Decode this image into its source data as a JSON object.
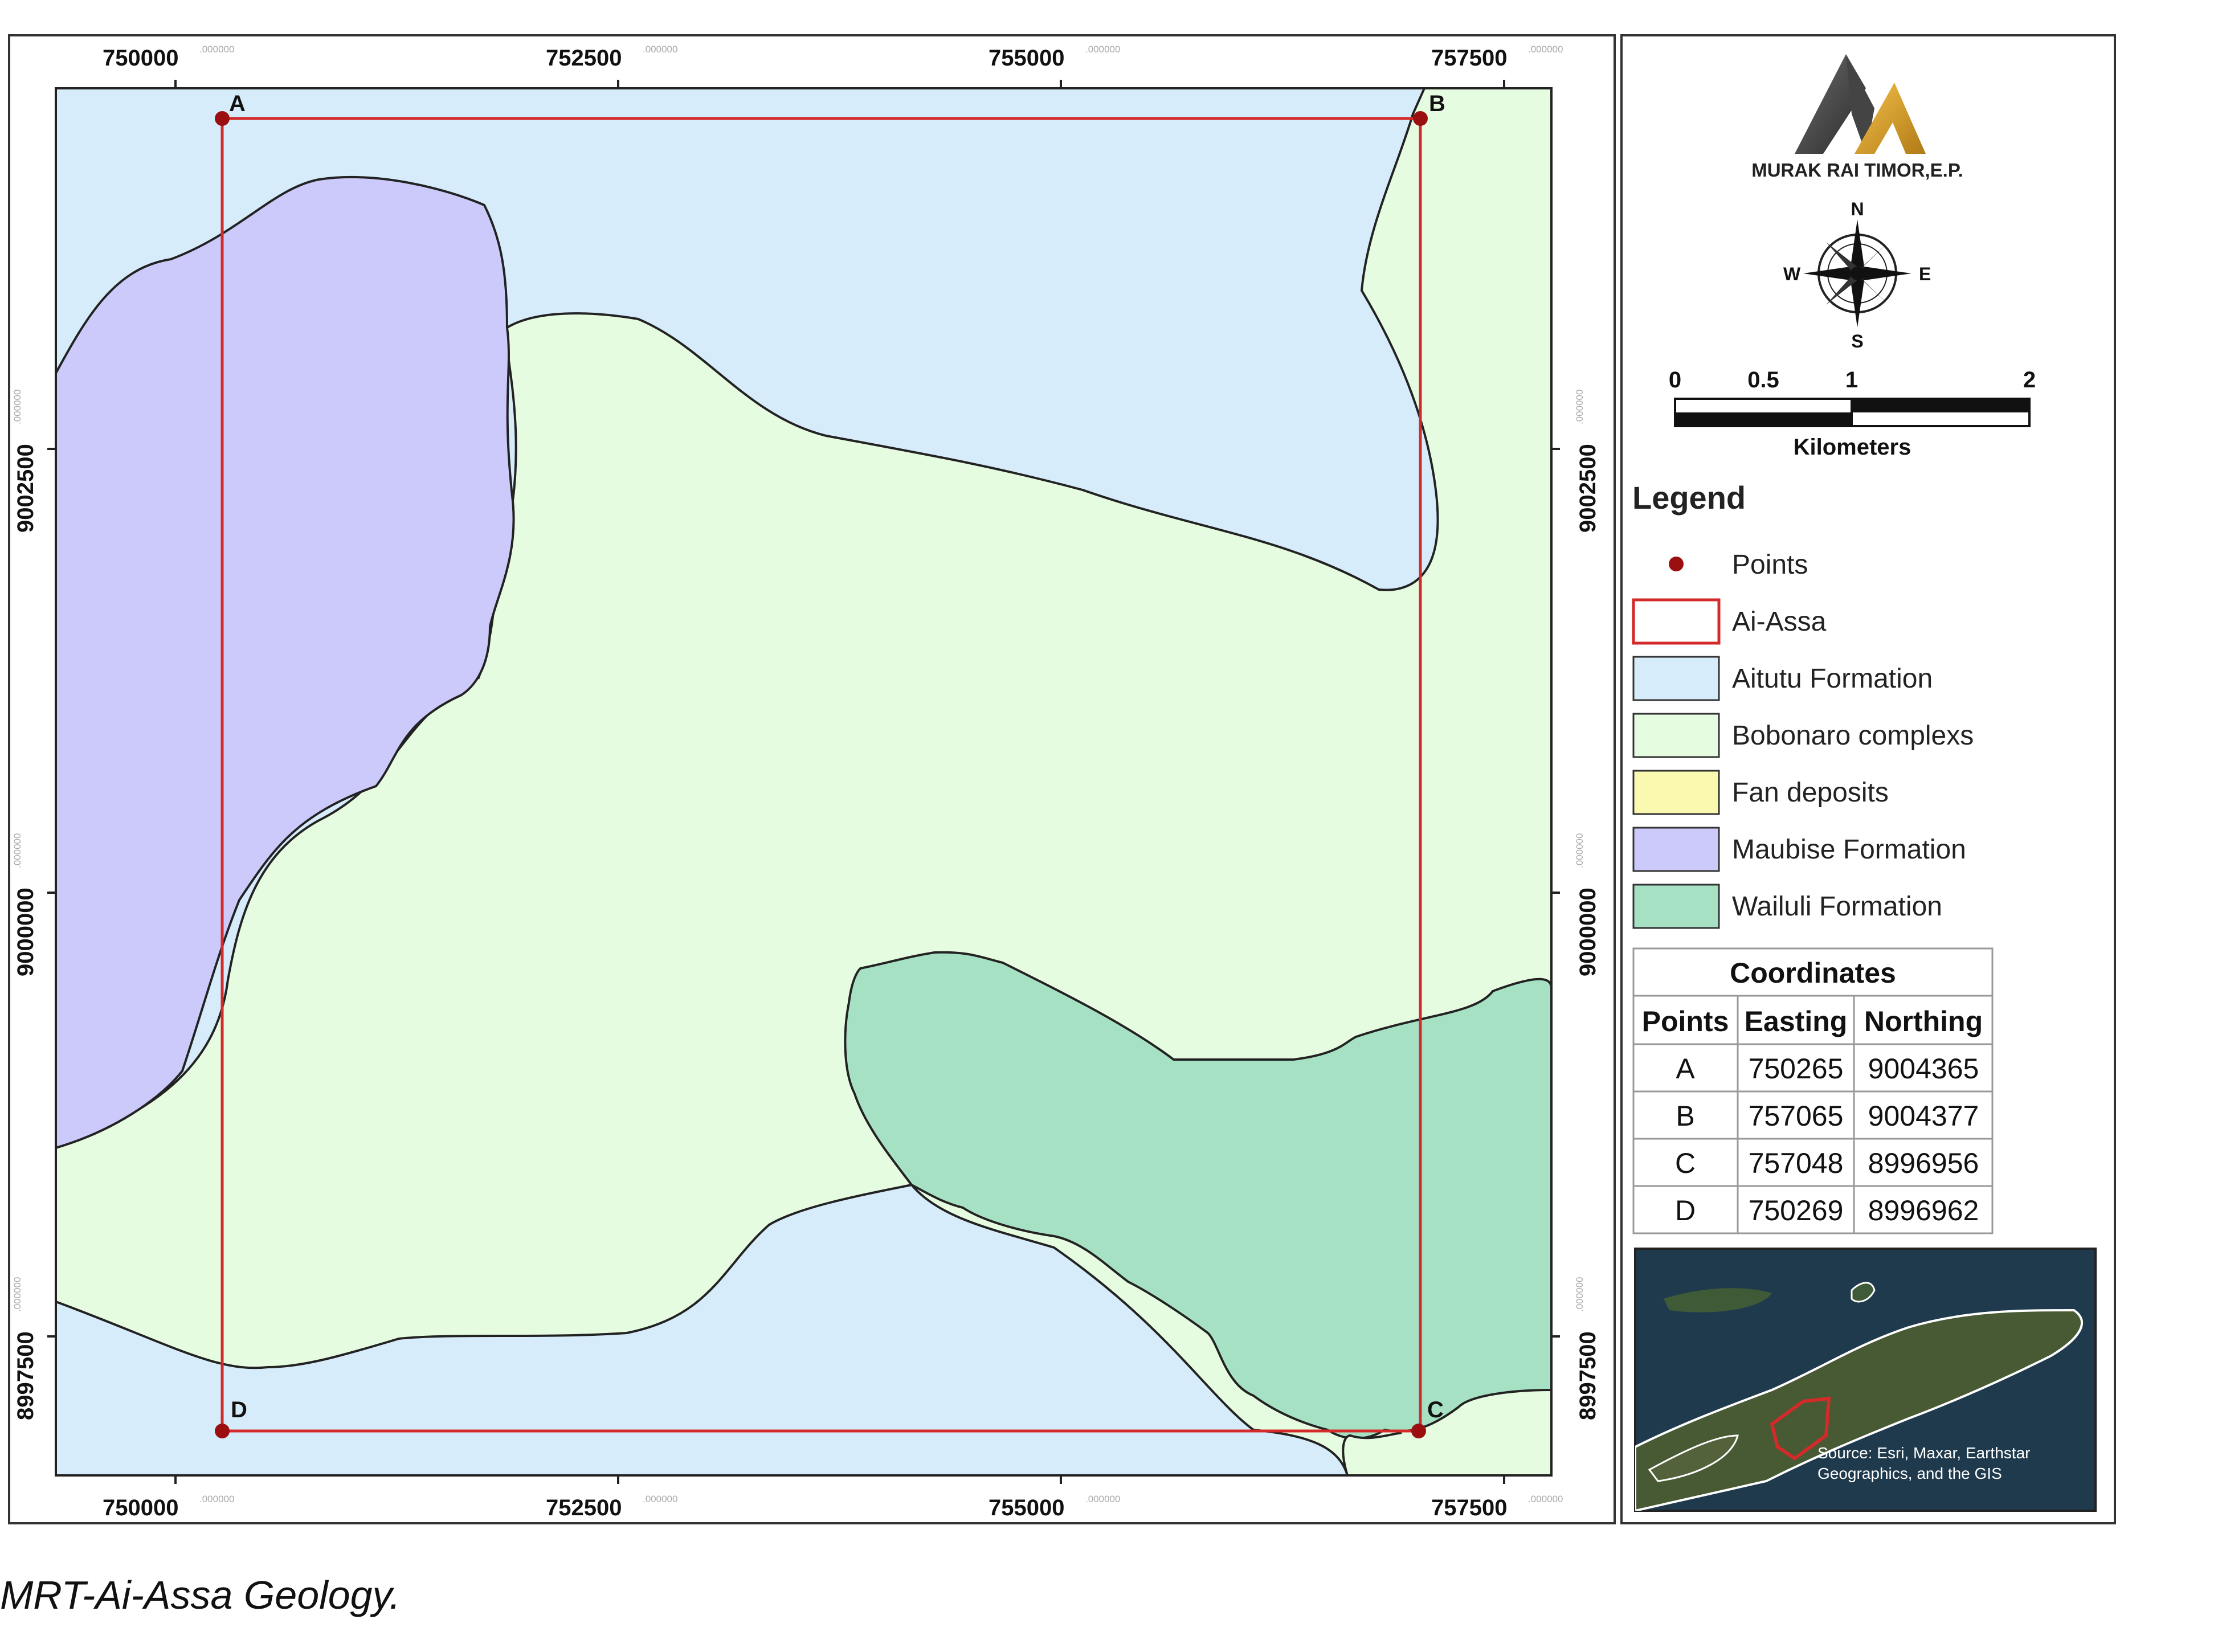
{
  "map": {
    "x_ticks": [
      {
        "main": "750000",
        "dec": ".000000"
      },
      {
        "main": "752500",
        "dec": ".000000"
      },
      {
        "main": "755000",
        "dec": ".000000"
      },
      {
        "main": "757500",
        "dec": ".000000"
      }
    ],
    "y_ticks": [
      {
        "main": "9002500",
        "dec": ".000000"
      },
      {
        "main": "9000000",
        "dec": ".000000"
      },
      {
        "main": "8997500",
        "dec": ".000000"
      }
    ],
    "points": [
      {
        "label": "A"
      },
      {
        "label": "B"
      },
      {
        "label": "C"
      },
      {
        "label": "D"
      }
    ]
  },
  "logo": {
    "text": "MURAK RAI TIMOR,E.P."
  },
  "north_arrow": {
    "n": "N",
    "s": "S",
    "e": "E",
    "w": "W"
  },
  "scale_bar": {
    "labels": [
      "0",
      "0.5",
      "1",
      "2"
    ],
    "unit": "Kilometers"
  },
  "legend": {
    "title": "Legend",
    "items": [
      {
        "label": "Points",
        "symbol": "dot",
        "color": "#9b0f10"
      },
      {
        "label": "Ai-Assa",
        "symbol": "outline",
        "color": "#d42a2a"
      },
      {
        "label": "Aitutu Formation",
        "symbol": "fill",
        "color": "#d6ecfb"
      },
      {
        "label": "Bobonaro complexs",
        "symbol": "fill",
        "color": "#e6fce0"
      },
      {
        "label": "Fan deposits",
        "symbol": "fill",
        "color": "#fbf8b0"
      },
      {
        "label": "Maubise Formation",
        "symbol": "fill",
        "color": "#cccafb"
      },
      {
        "label": "Wailuli Formation",
        "symbol": "fill",
        "color": "#a7e1c4"
      }
    ]
  },
  "coordinates_table": {
    "title": "Coordinates",
    "headers": [
      "Points",
      "Easting",
      "Northing"
    ],
    "rows": [
      [
        "A",
        "750265",
        "9004365"
      ],
      [
        "B",
        "757065",
        "9004377"
      ],
      [
        "C",
        "757048",
        "8996956"
      ],
      [
        "D",
        "750269",
        "8996962"
      ]
    ]
  },
  "inset": {
    "source": "Source: Esri, Maxar, Earthstar Geographics, and the GIS"
  },
  "caption": "MRT-Ai-Assa Geology.",
  "colors": {
    "aitutu": "#d6ecfb",
    "bobonaro": "#e6fce0",
    "maubise": "#cccafb",
    "wailuli": "#a7e1c4",
    "boundary": "#d42a2a",
    "point": "#9b0f10"
  }
}
